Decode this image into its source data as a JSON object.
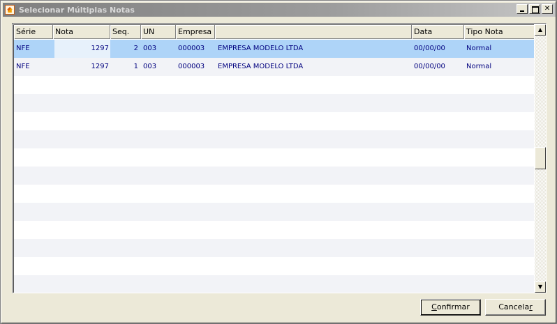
{
  "window": {
    "title": "Selecionar Múltiplas Notas"
  },
  "grid": {
    "columns": [
      "Série",
      "Nota",
      "Seq.",
      "UN",
      "Empresa",
      "",
      "Data",
      "Tipo Nota"
    ],
    "rows": [
      {
        "serie": "NFE",
        "nota": "1297",
        "seq": "2",
        "un": "003",
        "empresa": "000003",
        "nome": "EMPRESA MODELO LTDA",
        "data": "00/00/00",
        "tipo": "Normal"
      },
      {
        "serie": "NFE",
        "nota": "1297",
        "seq": "1",
        "un": "003",
        "empresa": "000003",
        "nome": "EMPRESA MODELO LTDA",
        "data": "00/00/00",
        "tipo": "Normal"
      }
    ]
  },
  "buttons": {
    "confirm": {
      "accel": "C",
      "rest": "onfirmar"
    },
    "cancel": {
      "pre": "Cancela",
      "accel": "r"
    }
  },
  "icons": {
    "app": "app-icon",
    "minimize": "minimize-icon",
    "maximize": "maximize-icon",
    "close": "close-icon",
    "scroll_up": "arrow-up-icon",
    "scroll_down": "arrow-down-icon"
  },
  "colors": {
    "selected_row": "#aed4f8",
    "alt_row": "#f2f3f7",
    "cell_text": "#00007f"
  }
}
